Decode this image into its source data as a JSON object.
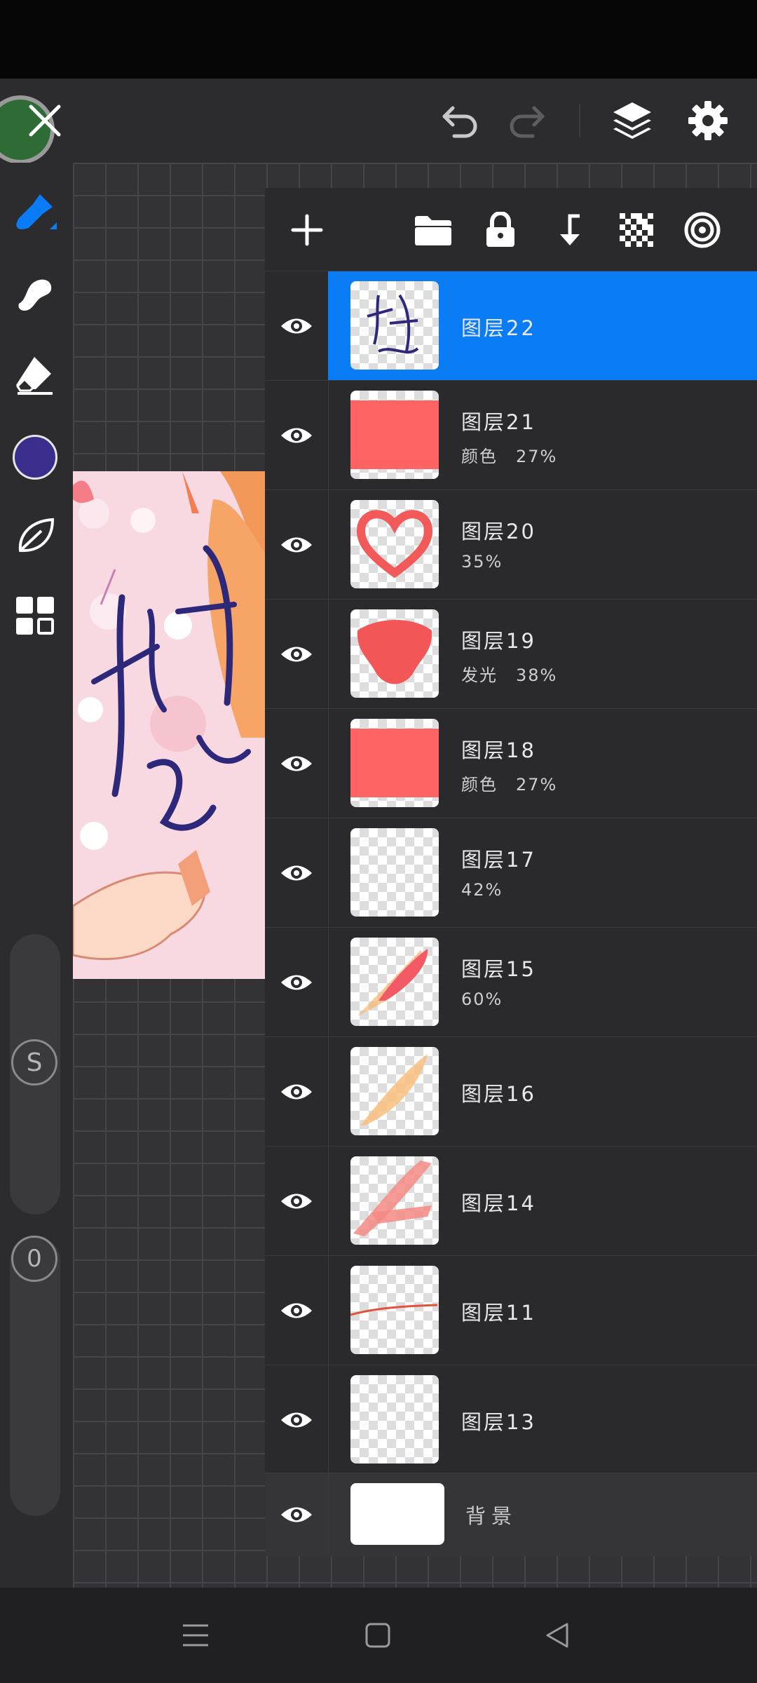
{
  "app": {
    "current_color": "#3a2e8c",
    "accent": "#0a7cf5"
  },
  "icons": {
    "close": "close-icon",
    "undo": "undo-icon",
    "redo": "redo-icon",
    "layers": "layers-icon",
    "settings": "gear-icon"
  },
  "tools": [
    "brush-icon",
    "smudge-icon",
    "eraser-icon",
    "color-swatch",
    "leaf-icon",
    "grid-icon"
  ],
  "sliders": {
    "size_label": "S",
    "opacity_label": "0"
  },
  "layers_panel": {
    "actions": [
      "add-layer-icon",
      "folder-icon",
      "lock-icon",
      "merge-down-icon",
      "transparency-icon",
      "layer-effects-icon"
    ],
    "layers": [
      {
        "name": "图层22",
        "meta": "",
        "selected": true,
        "thumb": "text"
      },
      {
        "name": "图层21",
        "meta": "颜色　27%",
        "selected": false,
        "thumb": "red"
      },
      {
        "name": "图层20",
        "meta": "35%",
        "selected": false,
        "thumb": "heart"
      },
      {
        "name": "图层19",
        "meta": "发光　38%",
        "selected": false,
        "thumb": "blob"
      },
      {
        "name": "图层18",
        "meta": "颜色　27%",
        "selected": false,
        "thumb": "red"
      },
      {
        "name": "图层17",
        "meta": "42%",
        "selected": false,
        "thumb": "empty"
      },
      {
        "name": "图层15",
        "meta": "60%",
        "selected": false,
        "thumb": "feather"
      },
      {
        "name": "图层16",
        "meta": "",
        "selected": false,
        "thumb": "stroke"
      },
      {
        "name": "图层14",
        "meta": "",
        "selected": false,
        "thumb": "vstroke"
      },
      {
        "name": "图层11",
        "meta": "",
        "selected": false,
        "thumb": "line"
      },
      {
        "name": "图层13",
        "meta": "",
        "selected": false,
        "thumb": "empty"
      }
    ],
    "background": {
      "name": "背景"
    }
  },
  "nav": [
    "menu-icon",
    "home-icon",
    "back-icon"
  ]
}
